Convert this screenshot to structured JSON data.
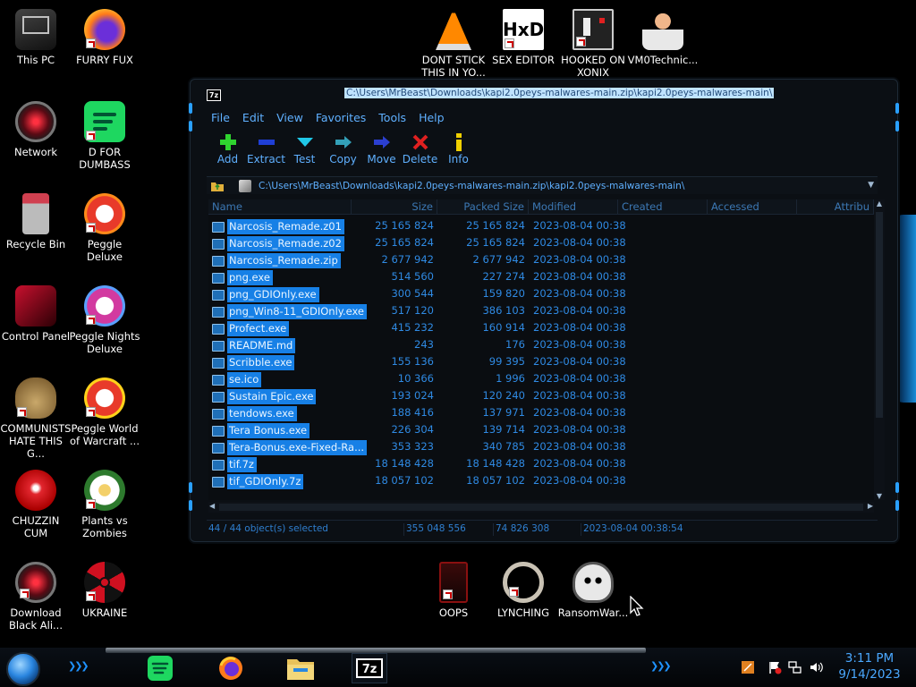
{
  "desktop_icons": [
    {
      "label": "This PC"
    },
    {
      "label": "FURRY FUX"
    },
    {
      "label": "Network"
    },
    {
      "label": "D FOR DUMBASS"
    },
    {
      "label": "Recycle Bin"
    },
    {
      "label": "Peggle Deluxe"
    },
    {
      "label": "Control Panel"
    },
    {
      "label": "Peggle Nights Deluxe"
    },
    {
      "label": "COMMUNISTS HATE THIS G..."
    },
    {
      "label": "Peggle World of Warcraft ..."
    },
    {
      "label": "CHUZZIN CUM"
    },
    {
      "label": "Plants vs Zombies"
    },
    {
      "label": "Download Black Ali..."
    },
    {
      "label": "UKRAINE"
    },
    {
      "label": "DONT STICK THIS IN YO..."
    },
    {
      "label": "SEX EDITOR"
    },
    {
      "label": "HOOKED ON XONIX"
    },
    {
      "label": "VM0Technic..."
    },
    {
      "label": "OOPS"
    },
    {
      "label": "LYNCHING"
    },
    {
      "label": "RansomWar..."
    }
  ],
  "window": {
    "title": "C:\\Users\\MrBeast\\Downloads\\kapi2.0peys-malwares-main.zip\\kapi2.0peys-malwares-main\\",
    "app_icon": "7z",
    "menu": [
      "File",
      "Edit",
      "View",
      "Favorites",
      "Tools",
      "Help"
    ],
    "toolbar": [
      {
        "label": "Add",
        "icon": "plus-icon",
        "color": "#2fd42f"
      },
      {
        "label": "Extract",
        "icon": "minus-icon",
        "color": "#1f3fd6"
      },
      {
        "label": "Test",
        "icon": "check-icon",
        "color": "#20c8e8"
      },
      {
        "label": "Copy",
        "icon": "copy-arrow-icon",
        "color": "#33a0b8"
      },
      {
        "label": "Move",
        "icon": "move-arrow-icon",
        "color": "#2b3fd0"
      },
      {
        "label": "Delete",
        "icon": "x-icon",
        "color": "#e02020"
      },
      {
        "label": "Info",
        "icon": "info-icon",
        "color": "#f0d000"
      }
    ],
    "address": "C:\\Users\\MrBeast\\Downloads\\kapi2.0peys-malwares-main.zip\\kapi2.0peys-malwares-main\\",
    "columns": [
      "Name",
      "Size",
      "Packed Size",
      "Modified",
      "Created",
      "Accessed",
      "Attribu"
    ],
    "files": [
      {
        "name": "Narcosis_Remade.z01",
        "size": "25 165 824",
        "packed": "25 165 824",
        "modified": "2023-08-04 00:38"
      },
      {
        "name": "Narcosis_Remade.z02",
        "size": "25 165 824",
        "packed": "25 165 824",
        "modified": "2023-08-04 00:38"
      },
      {
        "name": "Narcosis_Remade.zip",
        "size": "2 677 942",
        "packed": "2 677 942",
        "modified": "2023-08-04 00:38"
      },
      {
        "name": "png.exe",
        "size": "514 560",
        "packed": "227 274",
        "modified": "2023-08-04 00:38"
      },
      {
        "name": "png_GDIOnly.exe",
        "size": "300 544",
        "packed": "159 820",
        "modified": "2023-08-04 00:38"
      },
      {
        "name": "png_Win8-11_GDIOnly.exe",
        "size": "517 120",
        "packed": "386 103",
        "modified": "2023-08-04 00:38"
      },
      {
        "name": "Profect.exe",
        "size": "415 232",
        "packed": "160 914",
        "modified": "2023-08-04 00:38"
      },
      {
        "name": "README.md",
        "size": "243",
        "packed": "176",
        "modified": "2023-08-04 00:38"
      },
      {
        "name": "Scribble.exe",
        "size": "155 136",
        "packed": "99 395",
        "modified": "2023-08-04 00:38"
      },
      {
        "name": "se.ico",
        "size": "10 366",
        "packed": "1 996",
        "modified": "2023-08-04 00:38"
      },
      {
        "name": "Sustain Epic.exe",
        "size": "193 024",
        "packed": "120 240",
        "modified": "2023-08-04 00:38"
      },
      {
        "name": "tendows.exe",
        "size": "188 416",
        "packed": "137 971",
        "modified": "2023-08-04 00:38"
      },
      {
        "name": "Tera Bonus.exe",
        "size": "226 304",
        "packed": "139 714",
        "modified": "2023-08-04 00:38"
      },
      {
        "name": "Tera-Bonus.exe-Fixed-Ra...",
        "size": "353 323",
        "packed": "340 785",
        "modified": "2023-08-04 00:38"
      },
      {
        "name": "tif.7z",
        "size": "18 148 428",
        "packed": "18 148 428",
        "modified": "2023-08-04 00:38"
      },
      {
        "name": "tif_GDIOnly.7z",
        "size": "18 057 102",
        "packed": "18 057 102",
        "modified": "2023-08-04 00:38"
      }
    ],
    "status": {
      "selected": "44 / 44 object(s) selected",
      "size": "355 048 556",
      "packed": "74 826 308",
      "modified": "2023-08-04 00:38:54"
    }
  },
  "taskbar": {
    "apps": [
      "spotify-icon",
      "firefox-icon",
      "file-explorer-icon",
      "7zip-icon"
    ],
    "time": "3:11 PM",
    "date": "9/14/2023"
  }
}
